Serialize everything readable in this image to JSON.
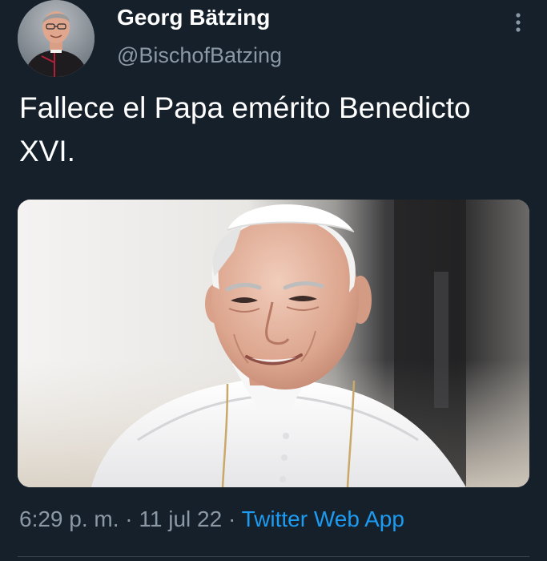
{
  "tweet": {
    "author": {
      "name": "Georg Bätzing",
      "handle": "@BischofBatzing"
    },
    "text": "Fallece el Papa emérito Benedicto XVI.",
    "time": "6:29 p. m.",
    "separator": "·",
    "date": "11 jul 22",
    "source": "Twitter Web App"
  },
  "icons": {
    "more": "more-vertical-icon"
  },
  "colors": {
    "background": "#15202b",
    "primary_text": "#ffffff",
    "secondary_text": "#8b98a5",
    "link": "#1d9bf0"
  }
}
